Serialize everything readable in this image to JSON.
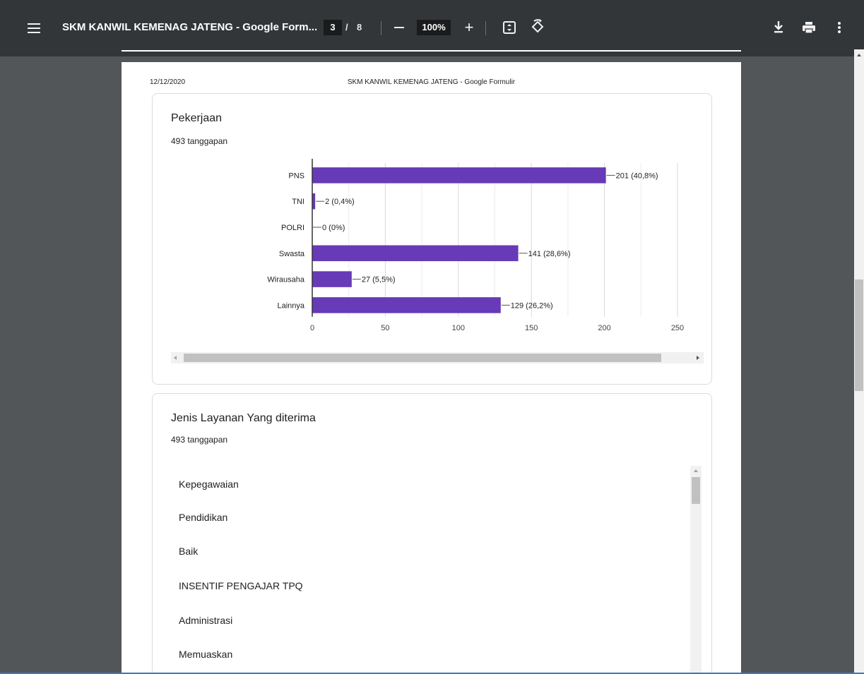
{
  "toolbar": {
    "title": "SKM KANWIL KEMENAG JATENG - Google Form...",
    "page_current": "3",
    "page_separator": "/",
    "page_total": "8",
    "zoom": "100%",
    "zoom_plus": "+",
    "icons": [
      "menu-icon",
      "zoom-out-icon",
      "zoom-in-icon",
      "fit-page-icon",
      "rotate-icon",
      "download-icon",
      "print-icon",
      "more-vert-icon"
    ]
  },
  "page_header": {
    "date": "12/12/2020",
    "title": "SKM KANWIL KEMENAG JATENG - Google Formulir"
  },
  "question1": {
    "title": "Pekerjaan",
    "responses": "493 tanggapan"
  },
  "chart_data": {
    "type": "bar",
    "orientation": "horizontal",
    "categories": [
      "PNS",
      "TNI",
      "POLRI",
      "Swasta",
      "Wirausaha",
      "Lainnya"
    ],
    "values": [
      201,
      2,
      0,
      141,
      27,
      129
    ],
    "data_labels": [
      "201 (40,8%)",
      "2 (0,4%)",
      "0 (0%)",
      "141 (28,6%)",
      "27 (5,5%)",
      "129 (26,2%)"
    ],
    "xlim": [
      0,
      250
    ],
    "xticks": [
      "0",
      "50",
      "100",
      "150",
      "200",
      "250"
    ],
    "grid": true,
    "bar_color": "#673ab7"
  },
  "question2": {
    "title": "Jenis Layanan Yang diterima",
    "responses": "493 tanggapan",
    "items": [
      "Kepegawaian",
      "Pendidikan",
      "Baik",
      "INSENTIF PENGAJAR TPQ",
      "Administrasi",
      "Memuaskan"
    ]
  }
}
